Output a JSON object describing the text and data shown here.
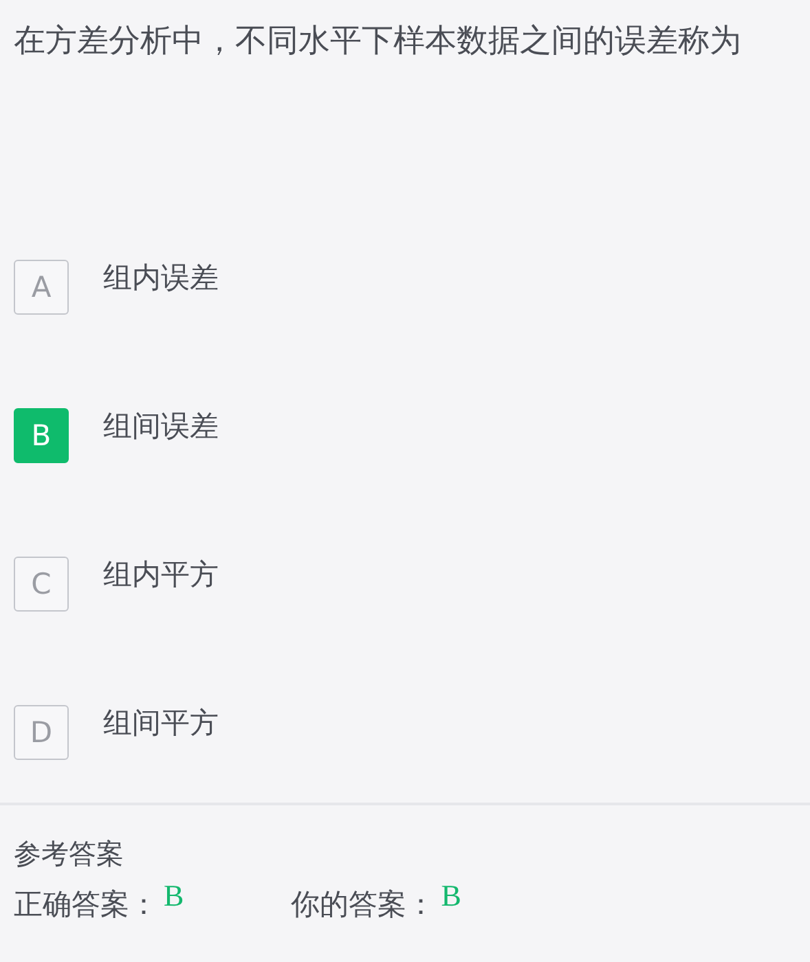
{
  "question": "在方差分析中，不同水平下样本数据之间的误差称为",
  "options": [
    {
      "letter": "A",
      "text": "组内误差",
      "selected": false
    },
    {
      "letter": "B",
      "text": "组间误差",
      "selected": true
    },
    {
      "letter": "C",
      "text": "组内平方",
      "selected": false
    },
    {
      "letter": "D",
      "text": "组间平方",
      "selected": false
    }
  ],
  "answer_section": {
    "title": "参考答案",
    "correct_label": "正确答案：",
    "correct_value": "B",
    "yours_label": "你的答案：",
    "yours_value": "B"
  }
}
